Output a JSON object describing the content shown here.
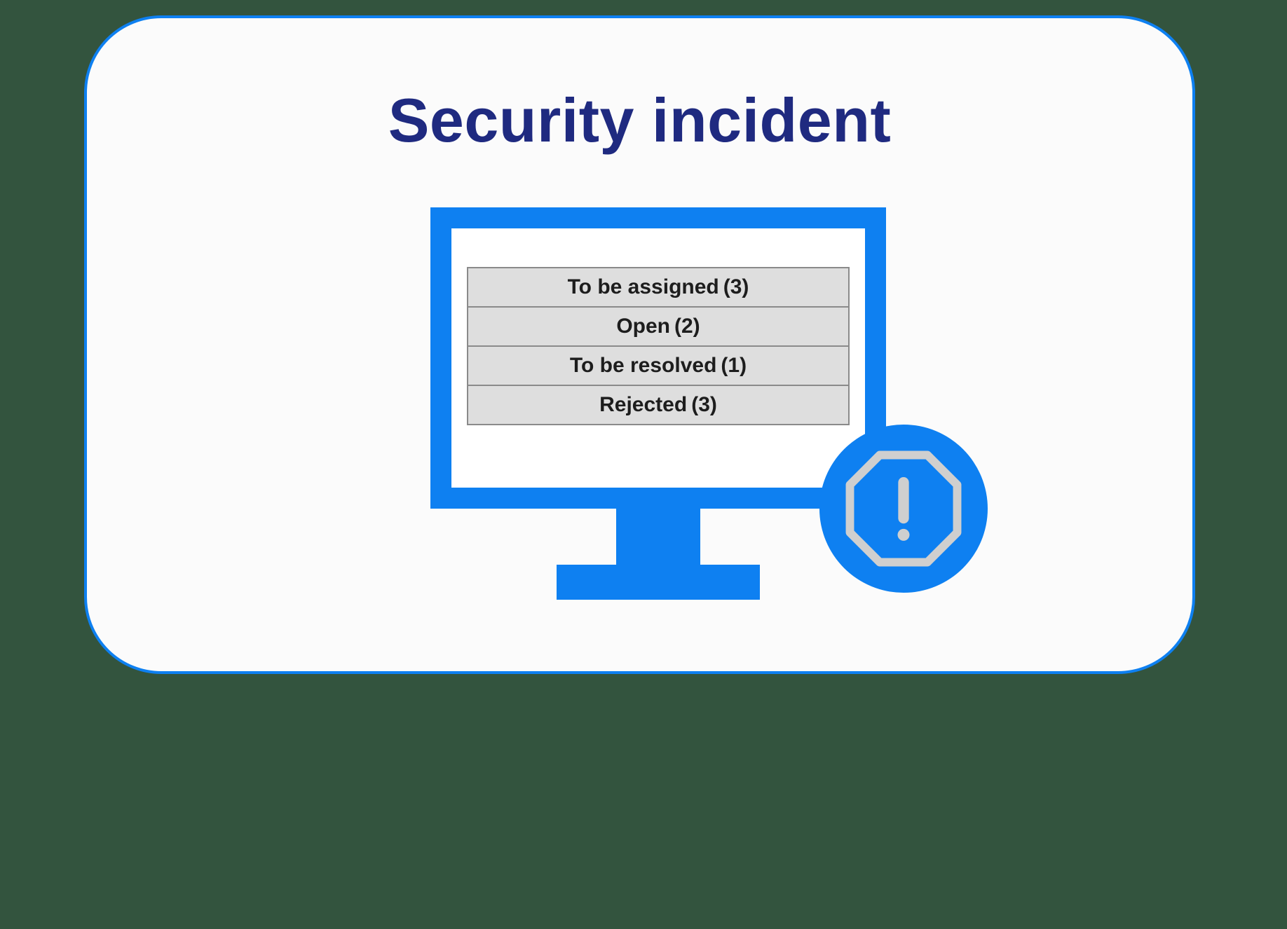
{
  "card": {
    "title": "Security incident"
  },
  "statuses": [
    {
      "label": "To be assigned",
      "count": "3"
    },
    {
      "label": "Open",
      "count": "2"
    },
    {
      "label": "To be resolved",
      "count": "1"
    },
    {
      "label": "Rejected",
      "count": "3"
    }
  ],
  "colors": {
    "page_bg": "#33543e",
    "card_bg": "#fbfbfb",
    "card_border": "#0e80f1",
    "title": "#1f2a80",
    "monitor": "#0e80f1",
    "row_bg": "#dedede",
    "row_border": "#8a8a8a",
    "badge": "#0e80f1",
    "octagon_stroke": "#cfcfcf"
  }
}
